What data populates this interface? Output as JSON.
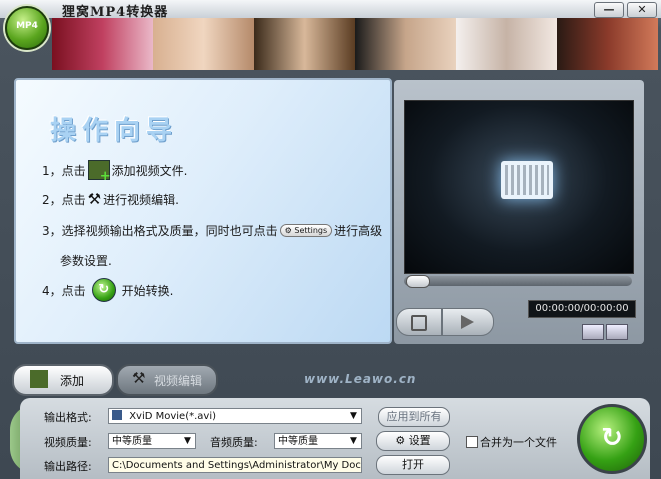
{
  "window": {
    "title": "狸窝MP4转换器",
    "logo_text": "MP4",
    "minimize_label": "—",
    "close_label": "✕"
  },
  "guide": {
    "title": "操作向导",
    "steps": {
      "s1_prefix": "1，点击",
      "s1_suffix": "添加视频文件.",
      "s2_prefix": "2，点击",
      "s2_suffix": "进行视频编辑.",
      "s3_prefix": "3，选择视频输出格式及质量，同时也可点击",
      "s3_settings": "Settings",
      "s3_suffix": "进行高级",
      "s3_cont": "参数设置.",
      "s4_prefix": "4，点击",
      "s4_suffix": "开始转换."
    }
  },
  "player": {
    "time": "00:00:00/00:00:00"
  },
  "toolbar": {
    "add_label": "添加",
    "edit_label": "视频编辑",
    "site": "www.Leawo.cn"
  },
  "output": {
    "format_label": "输出格式:",
    "format_value": "XviD Movie(*.avi)",
    "apply_all_label": "应用到所有",
    "video_quality_label": "视频质量:",
    "video_quality_value": "中等质量",
    "audio_quality_label": "音频质量:",
    "audio_quality_value": "中等质量",
    "settings_label": "设置",
    "merge_label": "合并为一个文件",
    "path_label": "输出路径:",
    "path_value": "C:\\Documents and Settings\\Administrator\\My Docur",
    "open_label": "打开"
  },
  "colors": {
    "accent_green": "#35a114",
    "guide_bg": "#dfeefb"
  },
  "icons": {
    "add": "add-video-icon",
    "edit": "edit-tools-icon",
    "start": "start-arrow-icon",
    "film": "film-icon"
  }
}
